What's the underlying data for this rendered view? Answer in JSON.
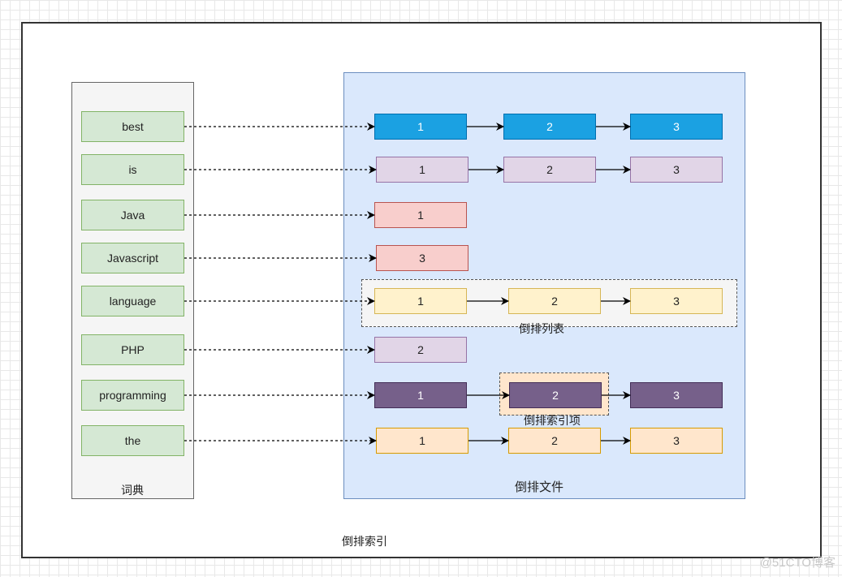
{
  "title": "倒排索引",
  "dictionary": {
    "label": "词典",
    "terms": [
      "best",
      "is",
      "Java",
      "Javascript",
      "language",
      "PHP",
      "programming",
      "the"
    ]
  },
  "inverted_file": {
    "label": "倒排文件",
    "posting_list_label": "倒排列表",
    "posting_item_label": "倒排索引项",
    "rows": [
      {
        "term": "best",
        "postings": [
          "1",
          "2",
          "3"
        ],
        "fill": "#1ba1e2",
        "stroke": "#006eaf",
        "text": "#ffffff"
      },
      {
        "term": "is",
        "postings": [
          "1",
          "2",
          "3"
        ],
        "fill": "#e1d5e7",
        "stroke": "#9673a6",
        "text": "#222222"
      },
      {
        "term": "Java",
        "postings": [
          "1"
        ],
        "fill": "#f8cecc",
        "stroke": "#b85450",
        "text": "#222222"
      },
      {
        "term": "Javascript",
        "postings": [
          "3"
        ],
        "fill": "#f8cecc",
        "stroke": "#b85450",
        "text": "#222222"
      },
      {
        "term": "language",
        "postings": [
          "1",
          "2",
          "3"
        ],
        "fill": "#fff2cc",
        "stroke": "#d6b656",
        "text": "#222222"
      },
      {
        "term": "PHP",
        "postings": [
          "2"
        ],
        "fill": "#e1d5e7",
        "stroke": "#9673a6",
        "text": "#222222"
      },
      {
        "term": "programming",
        "postings": [
          "1",
          "2",
          "3"
        ],
        "fill": "#76608a",
        "stroke": "#432d57",
        "text": "#ffffff"
      },
      {
        "term": "the",
        "postings": [
          "1",
          "2",
          "3"
        ],
        "fill": "#ffe6cc",
        "stroke": "#d79b00",
        "text": "#222222"
      }
    ]
  },
  "watermark": "@51CTO博客"
}
